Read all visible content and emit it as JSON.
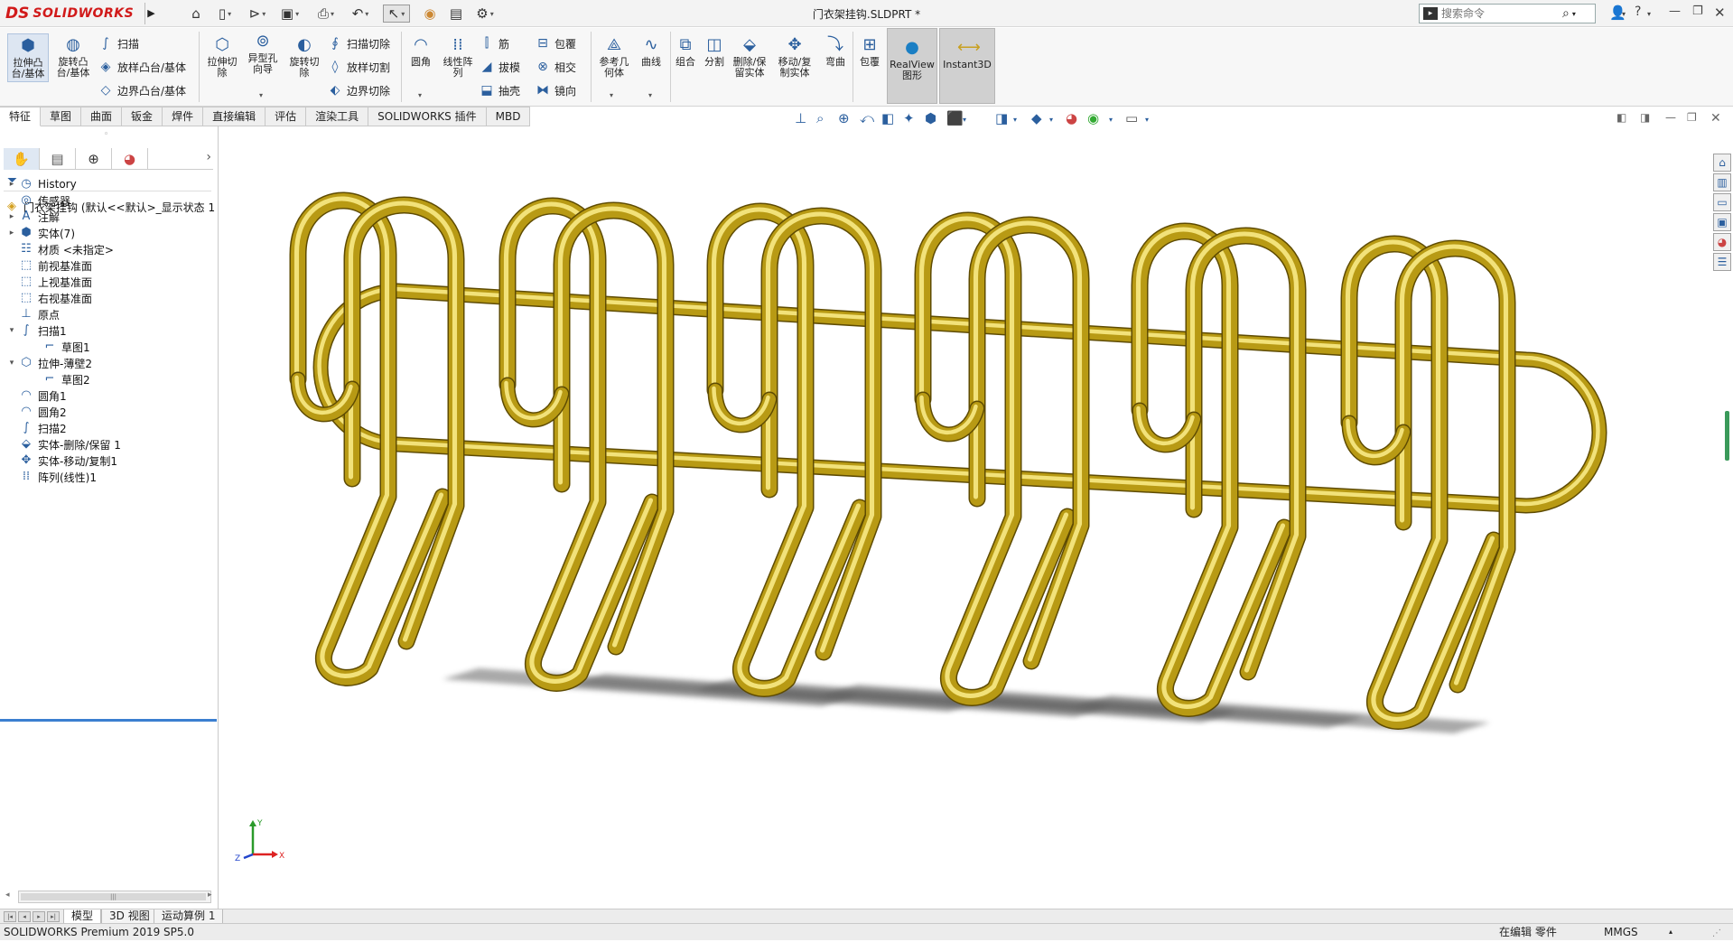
{
  "app": {
    "brand_ds": "DS",
    "brand_name": "SOLIDWORKS"
  },
  "title": {
    "document": "门衣架挂钩.SLDPRT *"
  },
  "search": {
    "placeholder": "搜索命令"
  },
  "ribbon": {
    "extrude_boss": "拉伸凸\n台/基体",
    "revolve_boss": "旋转凸\n台/基体",
    "sweep": "扫描",
    "loft_boss": "放样凸台/基体",
    "boundary_boss": "边界凸台/基体",
    "extrude_cut": "拉伸切\n除",
    "hole_wizard": "异型孔\n向导",
    "revolve_cut": "旋转切\n除",
    "sweep_cut": "扫描切除",
    "loft_cut": "放样切割",
    "boundary_cut": "边界切除",
    "fillet": "圆角",
    "linear_pattern": "线性阵\n列",
    "rib": "筋",
    "draft": "拔模",
    "shell": "抽壳",
    "wrap": "包覆",
    "intersect": "相交",
    "mirror": "镜向",
    "ref_geometry": "参考几\n何体",
    "curves": "曲线",
    "combine": "组合",
    "split": "分割",
    "delete_keep_body": "删除/保\n留实体",
    "move_copy_body": "移动/复\n制实体",
    "flex": "弯曲",
    "wrap2": "包覆",
    "realview": "RealView\n图形",
    "instant3d": "Instant3D"
  },
  "tabs": [
    "特征",
    "草图",
    "曲面",
    "钣金",
    "焊件",
    "直接编辑",
    "评估",
    "渲染工具",
    "SOLIDWORKS 插件",
    "MBD"
  ],
  "tree": {
    "root": "门衣架挂钩 (默认<<默认>_显示状态 1",
    "items": [
      {
        "label": "History",
        "icon": "history-icon",
        "toggle": "▸"
      },
      {
        "label": "传感器",
        "icon": "sensor-icon",
        "toggle": ""
      },
      {
        "label": "注解",
        "icon": "annotation-icon",
        "toggle": "▸"
      },
      {
        "label": "实体(7)",
        "icon": "solid-body-icon",
        "toggle": "▸"
      },
      {
        "label": "材质 <未指定>",
        "icon": "material-icon",
        "toggle": ""
      },
      {
        "label": "前视基准面",
        "icon": "plane-icon",
        "toggle": ""
      },
      {
        "label": "上视基准面",
        "icon": "plane-icon",
        "toggle": ""
      },
      {
        "label": "右视基准面",
        "icon": "plane-icon",
        "toggle": ""
      },
      {
        "label": "原点",
        "icon": "origin-icon",
        "toggle": ""
      },
      {
        "label": "扫描1",
        "icon": "sweep-icon",
        "toggle": "▾"
      },
      {
        "label": "草图1",
        "icon": "sketch-icon",
        "toggle": "",
        "indent": true
      },
      {
        "label": "拉伸-薄壁2",
        "icon": "extrude-icon",
        "toggle": "▾"
      },
      {
        "label": "草图2",
        "icon": "sketch-icon",
        "toggle": "",
        "indent": true
      },
      {
        "label": "圆角1",
        "icon": "fillet-icon",
        "toggle": ""
      },
      {
        "label": "圆角2",
        "icon": "fillet-icon",
        "toggle": ""
      },
      {
        "label": "扫描2",
        "icon": "sweep-icon",
        "toggle": ""
      },
      {
        "label": "实体-删除/保留 1",
        "icon": "delete-body-icon",
        "toggle": ""
      },
      {
        "label": "实体-移动/复制1",
        "icon": "move-body-icon",
        "toggle": ""
      },
      {
        "label": "阵列(线性)1",
        "icon": "linear-pattern-icon",
        "toggle": ""
      }
    ]
  },
  "bottom_tabs": [
    "模型",
    "3D 视图",
    "运动算例 1"
  ],
  "status": {
    "product": "SOLIDWORKS Premium 2019 SP5.0",
    "editing": "在编辑 零件",
    "units": "MMGS"
  },
  "triad": {
    "x": "X",
    "y": "Y",
    "z": "Z"
  },
  "colors": {
    "part": "#b89a14",
    "part_highlight": "#f2e27a",
    "part_dark": "#5e4b02",
    "brand": "#d11a1a"
  }
}
